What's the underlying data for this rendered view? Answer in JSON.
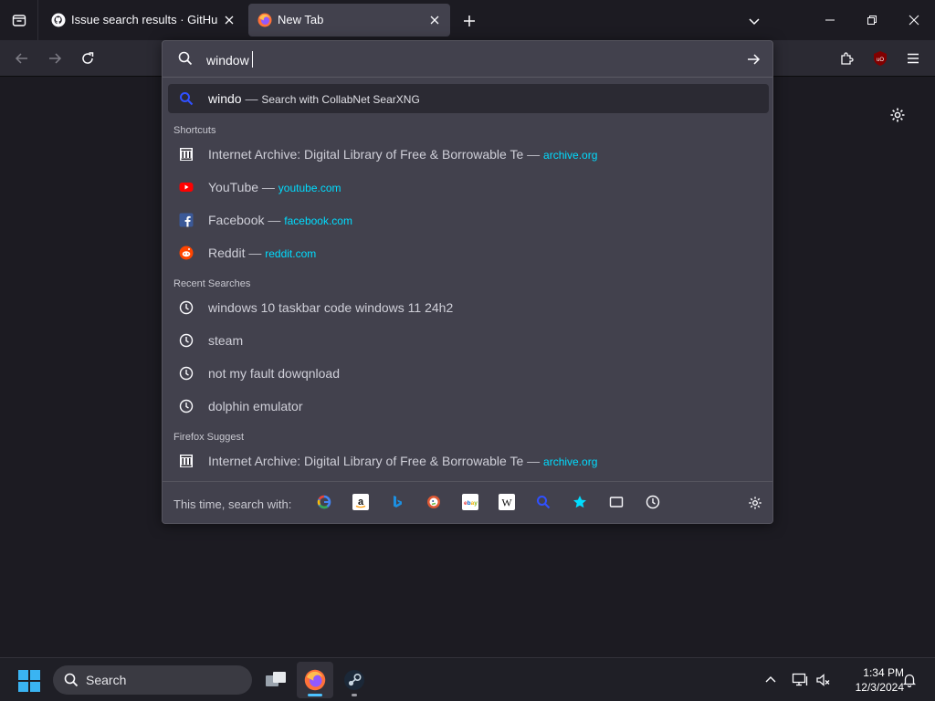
{
  "tabs": [
    {
      "title": "Issue search results · GitHub",
      "favicon": "github-icon"
    },
    {
      "title": "New Tab",
      "favicon": "firefox-icon"
    }
  ],
  "urlbar": {
    "value": "window",
    "heuristic": {
      "text": "windo",
      "action": "Search with CollabNet SearXNG"
    },
    "groups": {
      "shortcuts": "Shortcuts",
      "recent": "Recent Searches",
      "suggest": "Firefox Suggest"
    },
    "shortcuts": [
      {
        "title": "Internet Archive: Digital Library of Free & Borrowable Te",
        "url": "archive.org",
        "icon": "archive-icon"
      },
      {
        "title": "YouTube",
        "url": "youtube.com",
        "icon": "youtube-icon"
      },
      {
        "title": "Facebook",
        "url": "facebook.com",
        "icon": "facebook-icon"
      },
      {
        "title": "Reddit",
        "url": "reddit.com",
        "icon": "reddit-icon"
      }
    ],
    "recent": [
      "windows 10 taskbar code windows 11 24h2",
      "steam",
      "not my fault dowqnload",
      "dolphin emulator"
    ],
    "suggest": [
      {
        "title": "Internet Archive: Digital Library of Free & Borrowable Te",
        "url": "archive.org",
        "icon": "archive-icon"
      }
    ],
    "separator": "—",
    "oneoff_label": "This time, search with:"
  },
  "taskbar": {
    "search_label": "Search",
    "time": "1:34 PM",
    "date": "12/3/2024"
  },
  "colors": {
    "accent": "#00ddff",
    "dropdown_bg": "#42414d",
    "toolbar_bg": "#2b2a33"
  }
}
